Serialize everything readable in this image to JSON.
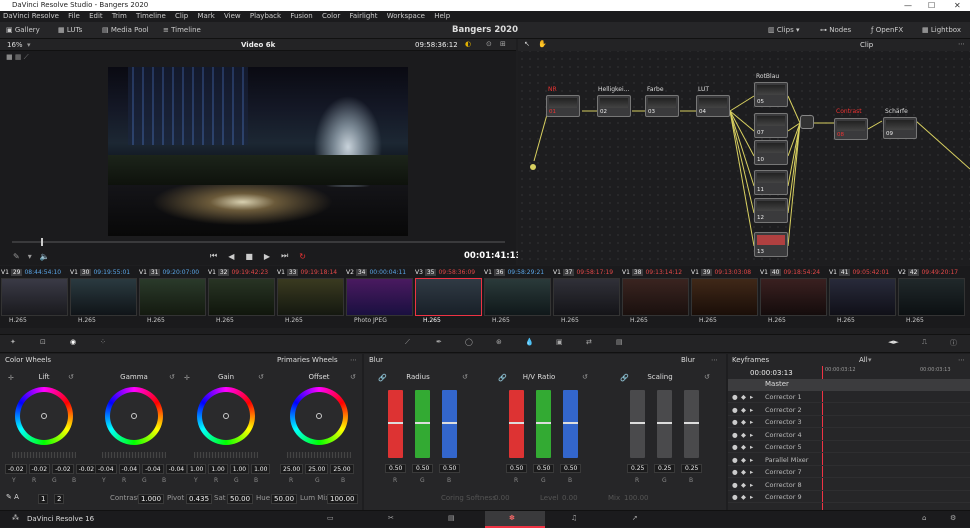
{
  "window": {
    "title": "DaVinci Resolve Studio - Bangers 2020",
    "controls": [
      "—",
      "☐",
      "✕"
    ]
  },
  "menu": [
    "DaVinci Resolve",
    "File",
    "Edit",
    "Trim",
    "Timeline",
    "Clip",
    "Mark",
    "View",
    "Playback",
    "Fusion",
    "Color",
    "Fairlight",
    "Workspace",
    "Help"
  ],
  "toolbar": {
    "gallery": "Gallery",
    "luts": "LUTs",
    "media_pool": "Media Pool",
    "timeline": "Timeline",
    "project": "Bangers 2020",
    "clips": "Clips",
    "nodes": "Nodes",
    "openfx": "OpenFX",
    "lightbox": "Lightbox"
  },
  "viewer": {
    "zoom": "16%",
    "timeline_name": "Video 6k",
    "timecode": "09:58:36:12",
    "playhead_tc": "00:01:41:13",
    "node_mode": "Clip"
  },
  "nodes": [
    {
      "label": "NR",
      "num": "01",
      "red": true
    },
    {
      "label": "Helligkei...",
      "num": "02",
      "red": false
    },
    {
      "label": "Farbe",
      "num": "03",
      "red": false
    },
    {
      "label": "LUT",
      "num": "04",
      "red": false
    },
    {
      "label": "RotBlau",
      "num": "05",
      "red": false
    },
    {
      "label": "",
      "num": "07",
      "red": false
    },
    {
      "label": "",
      "num": "10",
      "red": false
    },
    {
      "label": "",
      "num": "11",
      "red": false
    },
    {
      "label": "",
      "num": "12",
      "red": false
    },
    {
      "label": "",
      "num": "13",
      "red": false
    },
    {
      "label": "Contrast",
      "num": "08",
      "red": true
    },
    {
      "label": "Schärfe",
      "num": "09",
      "red": false
    }
  ],
  "clips": [
    {
      "track": "V1",
      "num": "29",
      "tc": "08:44:54:10",
      "codec": "H.265",
      "red": false
    },
    {
      "track": "V1",
      "num": "30",
      "tc": "09:19:55:01",
      "codec": "H.265",
      "red": false
    },
    {
      "track": "V1",
      "num": "31",
      "tc": "09:20:07:00",
      "codec": "H.265",
      "red": false
    },
    {
      "track": "V1",
      "num": "32",
      "tc": "09:19:42:23",
      "codec": "H.265",
      "red": true
    },
    {
      "track": "V1",
      "num": "33",
      "tc": "09:19:18:14",
      "codec": "H.265",
      "red": true
    },
    {
      "track": "V2",
      "num": "34",
      "tc": "00:00:04:11",
      "codec": "Photo JPEG",
      "red": false
    },
    {
      "track": "V3",
      "num": "35",
      "tc": "09:58:36:09",
      "codec": "H.265",
      "red": true
    },
    {
      "track": "V1",
      "num": "36",
      "tc": "09:58:29:21",
      "codec": "H.265",
      "red": false
    },
    {
      "track": "V1",
      "num": "37",
      "tc": "09:58:17:19",
      "codec": "H.265",
      "red": true
    },
    {
      "track": "V1",
      "num": "38",
      "tc": "09:13:14:12",
      "codec": "H.265",
      "red": true
    },
    {
      "track": "V1",
      "num": "39",
      "tc": "09:13:03:08",
      "codec": "H.265",
      "red": true
    },
    {
      "track": "V1",
      "num": "40",
      "tc": "09:18:54:24",
      "codec": "H.265",
      "red": true
    },
    {
      "track": "V1",
      "num": "41",
      "tc": "09:05:42:01",
      "codec": "H.265",
      "red": true
    },
    {
      "track": "V2",
      "num": "42",
      "tc": "09:49:20:17",
      "codec": "H.265",
      "red": true
    }
  ],
  "color_wheels": {
    "title": "Color Wheels",
    "mode": "Primaries Wheels",
    "wheels": [
      {
        "name": "Lift",
        "vals": [
          "-0.02",
          "-0.02",
          "-0.02",
          "-0.02"
        ]
      },
      {
        "name": "Gamma",
        "vals": [
          "-0.04",
          "-0.04",
          "-0.04",
          "-0.04"
        ]
      },
      {
        "name": "Gain",
        "vals": [
          "1.00",
          "1.00",
          "1.00",
          "1.00"
        ]
      },
      {
        "name": "Offset",
        "vals": [
          "25.00",
          "25.00",
          "25.00"
        ]
      }
    ],
    "ch4": [
      "Y",
      "R",
      "G",
      "B"
    ],
    "ch3": [
      "R",
      "G",
      "B"
    ],
    "page": [
      "1",
      "2"
    ],
    "contrast_label": "Contrast",
    "contrast": "1.000",
    "pivot_label": "Pivot",
    "pivot": "0.435",
    "sat_label": "Sat",
    "sat": "50.00",
    "hue_label": "Hue",
    "hue": "50.00",
    "lummix_label": "Lum Mix",
    "lummix": "100.00"
  },
  "blur": {
    "title": "Blur",
    "mode": "Blur",
    "groups": [
      {
        "name": "Radius",
        "vals": [
          "0.50",
          "0.50",
          "0.50"
        ]
      },
      {
        "name": "H/V Ratio",
        "vals": [
          "0.50",
          "0.50",
          "0.50"
        ]
      },
      {
        "name": "Scaling",
        "vals": [
          "0.25",
          "0.25",
          "0.25"
        ]
      }
    ],
    "coring_label": "Coring Softness",
    "coring": "0.00",
    "level_label": "Level",
    "level": "0.00",
    "mix_label": "Mix",
    "mix": "100.00"
  },
  "keyframes": {
    "title": "Keyframes",
    "filter": "All",
    "tc": "00:00:03:13",
    "tc2": "00:00:03:12",
    "tc3": "00:00:03:13",
    "master": "Master",
    "rows": [
      "Corrector 1",
      "Corrector 2",
      "Corrector 3",
      "Corrector 4",
      "Corrector 5",
      "Parallel Mixer",
      "Corrector 7",
      "Corrector 8",
      "Corrector 9"
    ]
  },
  "status": {
    "app": "DaVinci Resolve 16"
  }
}
